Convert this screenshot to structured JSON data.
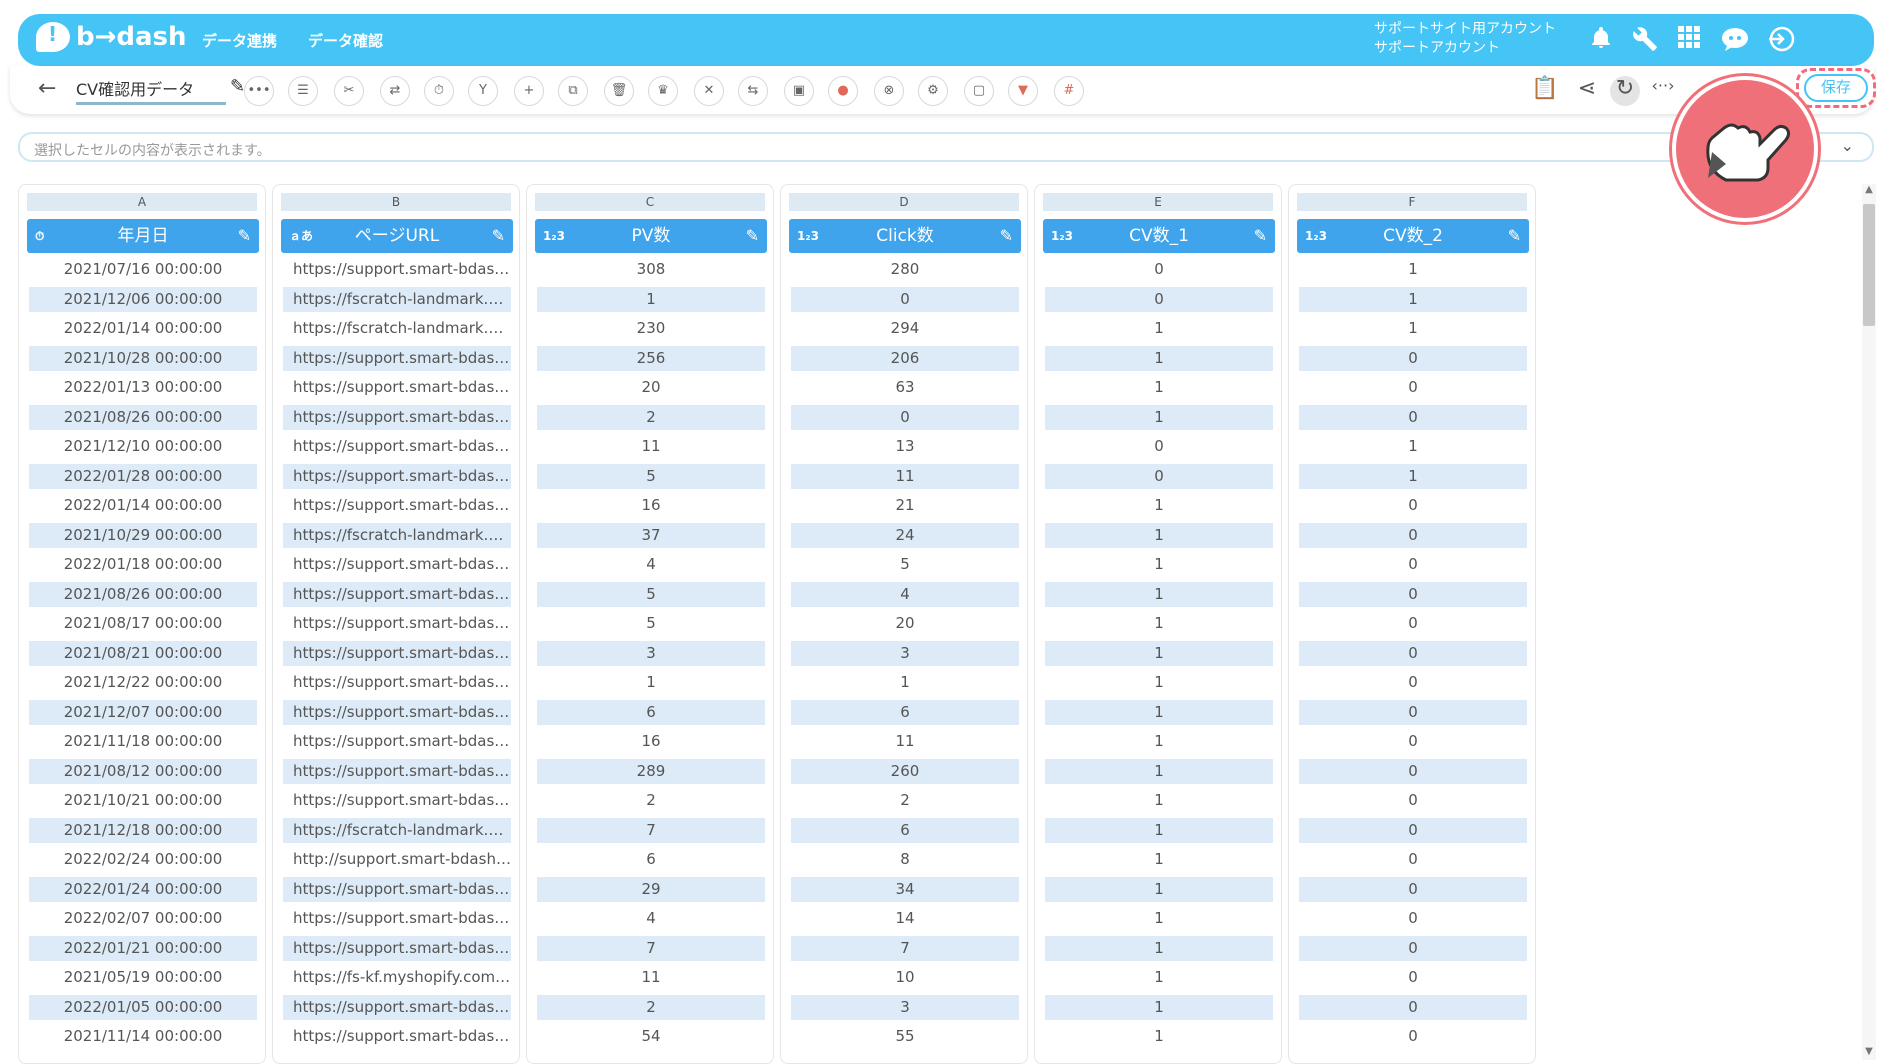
{
  "header": {
    "logo": "b→dash",
    "nav": [
      "データ連携",
      "データ確認"
    ],
    "account_line1": "サポートサイト用アカウント",
    "account_line2": "サポートアカウント"
  },
  "toolbar": {
    "sheet_name": "CV確認用データ",
    "save_label": "保存"
  },
  "cellbar": {
    "placeholder": "選択したセルの内容が表示されます。"
  },
  "columns": [
    {
      "letter": "A",
      "name": "年月日",
      "type": "date"
    },
    {
      "letter": "B",
      "name": "ページURL",
      "type": "text"
    },
    {
      "letter": "C",
      "name": "PV数",
      "type": "number"
    },
    {
      "letter": "D",
      "name": "Click数",
      "type": "number"
    },
    {
      "letter": "E",
      "name": "CV数_1",
      "type": "number"
    },
    {
      "letter": "F",
      "name": "CV数_2",
      "type": "number"
    }
  ],
  "rows": [
    [
      "2021/07/16 00:00:00",
      "https://support.smart-bdash...",
      "308",
      "280",
      "0",
      "1"
    ],
    [
      "2021/12/06 00:00:00",
      "https://fscratch-landmark.co...",
      "1",
      "0",
      "0",
      "1"
    ],
    [
      "2022/01/14 00:00:00",
      "https://fscratch-landmark.co...",
      "230",
      "294",
      "1",
      "1"
    ],
    [
      "2021/10/28 00:00:00",
      "https://support.smart-bdash...",
      "256",
      "206",
      "1",
      "0"
    ],
    [
      "2022/01/13 00:00:00",
      "https://support.smart-bdash...",
      "20",
      "63",
      "1",
      "0"
    ],
    [
      "2021/08/26 00:00:00",
      "https://support.smart-bdash...",
      "2",
      "0",
      "1",
      "0"
    ],
    [
      "2021/12/10 00:00:00",
      "https://support.smart-bdash...",
      "11",
      "13",
      "0",
      "1"
    ],
    [
      "2022/01/28 00:00:00",
      "https://support.smart-bdash...",
      "5",
      "11",
      "0",
      "1"
    ],
    [
      "2022/01/14 00:00:00",
      "https://support.smart-bdash...",
      "16",
      "21",
      "1",
      "0"
    ],
    [
      "2021/10/29 00:00:00",
      "https://fscratch-landmark.co...",
      "37",
      "24",
      "1",
      "0"
    ],
    [
      "2022/01/18 00:00:00",
      "https://support.smart-bdash...",
      "4",
      "5",
      "1",
      "0"
    ],
    [
      "2021/08/26 00:00:00",
      "https://support.smart-bdash...",
      "5",
      "4",
      "1",
      "0"
    ],
    [
      "2021/08/17 00:00:00",
      "https://support.smart-bdash...",
      "5",
      "20",
      "1",
      "0"
    ],
    [
      "2021/08/21 00:00:00",
      "https://support.smart-bdash...",
      "3",
      "3",
      "1",
      "0"
    ],
    [
      "2021/12/22 00:00:00",
      "https://support.smart-bdash...",
      "1",
      "1",
      "1",
      "0"
    ],
    [
      "2021/12/07 00:00:00",
      "https://support.smart-bdash...",
      "6",
      "6",
      "1",
      "0"
    ],
    [
      "2021/11/18 00:00:00",
      "https://support.smart-bdash...",
      "16",
      "11",
      "1",
      "0"
    ],
    [
      "2021/08/12 00:00:00",
      "https://support.smart-bdash...",
      "289",
      "260",
      "1",
      "0"
    ],
    [
      "2021/10/21 00:00:00",
      "https://support.smart-bdash...",
      "2",
      "2",
      "1",
      "0"
    ],
    [
      "2021/12/18 00:00:00",
      "https://fscratch-landmark.co...",
      "7",
      "6",
      "1",
      "0"
    ],
    [
      "2022/02/24 00:00:00",
      "http://support.smart-bdash....",
      "6",
      "8",
      "1",
      "0"
    ],
    [
      "2022/01/24 00:00:00",
      "https://support.smart-bdash...",
      "29",
      "34",
      "1",
      "0"
    ],
    [
      "2022/02/07 00:00:00",
      "https://support.smart-bdash...",
      "4",
      "14",
      "1",
      "0"
    ],
    [
      "2022/01/21 00:00:00",
      "https://support.smart-bdash...",
      "7",
      "7",
      "1",
      "0"
    ],
    [
      "2021/05/19 00:00:00",
      "https://fs-kf.myshopify.com/...",
      "11",
      "10",
      "1",
      "0"
    ],
    [
      "2022/01/05 00:00:00",
      "https://support.smart-bdash...",
      "2",
      "3",
      "1",
      "0"
    ],
    [
      "2021/11/14 00:00:00",
      "https://support.smart-bdash...",
      "54",
      "55",
      "1",
      "0"
    ]
  ],
  "colors": {
    "header_bg": "#45c4f6",
    "column_header_bg": "#3fa4ec",
    "row_alt_bg": "#dcebf7",
    "highlight": "#f0707a"
  }
}
